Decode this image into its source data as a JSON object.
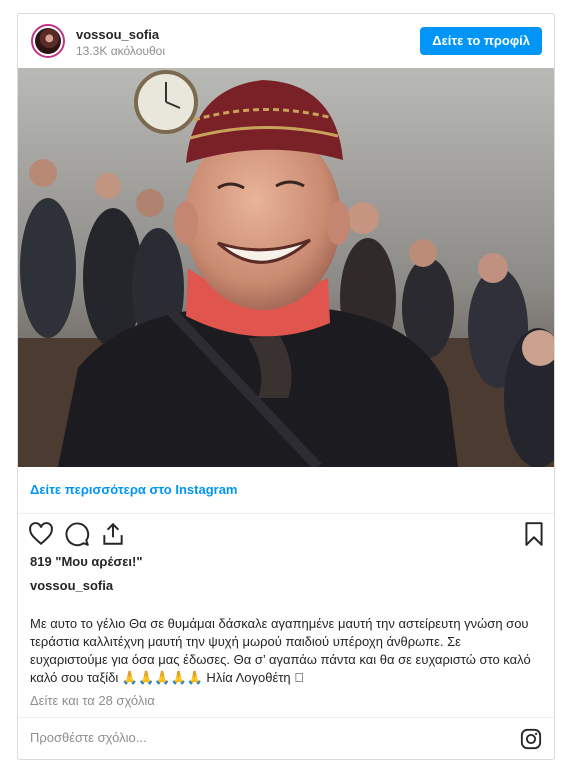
{
  "header": {
    "username": "vossou_sofia",
    "followers": "13.3K ακόλουθοι",
    "profile_button": "Δείτε το προφίλ"
  },
  "photo": {
    "description_icon": "photo"
  },
  "links": {
    "see_more": "Δείτε περισσότερα στο Instagram"
  },
  "actions": {
    "icons": [
      "heart-icon",
      "comment-icon",
      "share-icon",
      "bookmark-icon"
    ]
  },
  "post": {
    "likes": "819 \"Μου αρέσει!\"",
    "author": "vossou_sofia",
    "caption": "Με αυτο το γέλιο Θα σε θυμάμαι δάσκαλε αγαπημένε μαυτή την αστείρευτη γνώση σου τεράστια καλλιτέχνη μαυτή την ψυχή μωρού παιδιού υπέροχη άνθρωπε. Σε ευχαριστούμε για όσα μας έδωσες. Θα σ’ αγαπάω πάντα και θα σε ευχαριστώ στο καλό καλό σου ταξίδι 🙏🙏🙏🙏🙏 Ηλία Λογοθέτη 󾓬",
    "comments_link": "Δείτε και τα 28 σχόλια"
  },
  "comment": {
    "placeholder": "Προσθέστε σχόλιο..."
  },
  "colors": {
    "accent": "#0095f6",
    "text": "#262626",
    "muted": "#8e8e8e"
  }
}
